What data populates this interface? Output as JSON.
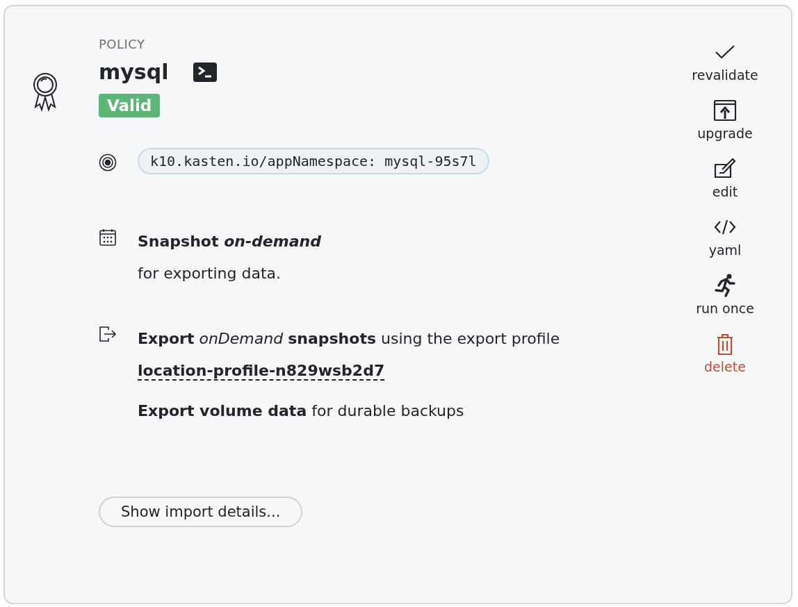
{
  "header": {
    "label": "POLICY",
    "name": "mysql",
    "status": "Valid"
  },
  "selector": {
    "text": "k10.kasten.io/appNamespace: mysql-95s7l"
  },
  "snapshot": {
    "title": "Snapshot *on-demand*",
    "detail": "for exporting data."
  },
  "export": {
    "sentence": "**Export** *onDemand* **snapshots** using the export profile",
    "profile_link": "location-profile-n829wsb2d7",
    "volume": "**Export volume data** for durable backups"
  },
  "import_button": "Show import details...",
  "actions": [
    {
      "kind": "check",
      "label": "revalidate",
      "danger": false
    },
    {
      "kind": "upgrade",
      "label": "upgrade",
      "danger": false
    },
    {
      "kind": "edit",
      "label": "edit",
      "danger": false
    },
    {
      "kind": "code",
      "label": "yaml",
      "danger": false
    },
    {
      "kind": "run",
      "label": "run once",
      "danger": false
    },
    {
      "kind": "delete",
      "label": "delete",
      "danger": true
    }
  ]
}
